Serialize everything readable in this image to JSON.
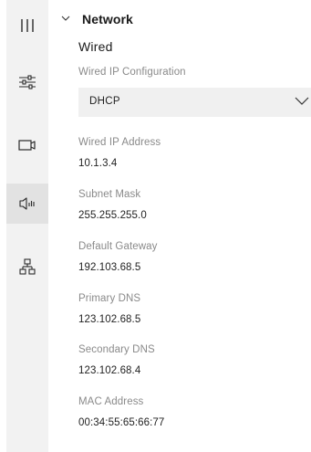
{
  "rail": {
    "items": [
      {
        "icon": "menu-bars-icon"
      },
      {
        "icon": "sliders-icon"
      },
      {
        "icon": "video-camera-icon"
      },
      {
        "icon": "audio-speaker-icon"
      },
      {
        "icon": "network-icon"
      }
    ],
    "active_index": 3
  },
  "network": {
    "section_title": "Network",
    "subsection_title": "Wired",
    "ip_config": {
      "label": "Wired IP Configuration",
      "value": "DHCP"
    },
    "fields": {
      "ip_address": {
        "label": "Wired IP Address",
        "value": "10.1.3.4"
      },
      "subnet_mask": {
        "label": "Subnet Mask",
        "value": "255.255.255.0"
      },
      "default_gateway": {
        "label": "Default Gateway",
        "value": "192.103.68.5"
      },
      "primary_dns": {
        "label": "Primary DNS",
        "value": "123.102.68.5"
      },
      "secondary_dns": {
        "label": "Secondary DNS",
        "value": "123.102.68.4"
      },
      "mac_address": {
        "label": "MAC Address",
        "value": "00:34:55:65:66:77"
      }
    }
  },
  "colors": {
    "rail_background": "#f2f2f2",
    "rail_active": "#e2e2e2",
    "select_background": "#f0f0f0",
    "label_text": "#8a8a8a",
    "value_text": "#1f1f1f"
  }
}
